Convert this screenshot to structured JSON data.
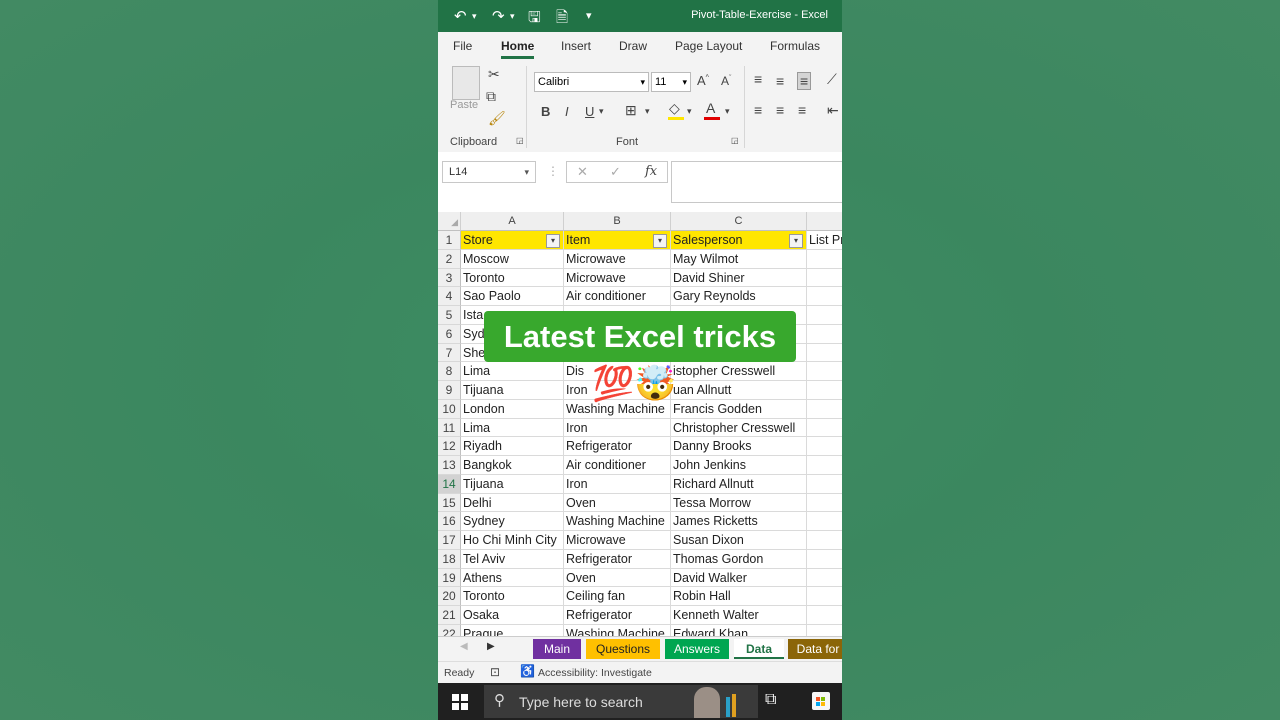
{
  "window": {
    "doc_title": "Pivot-Table-Exercise  -  Excel",
    "quick_access": {
      "undo": "↶",
      "redo": "↷",
      "save": "🖫",
      "touch": "🗎",
      "customize": "▾"
    }
  },
  "ribbon": {
    "tabs": [
      {
        "label": "File",
        "active": false
      },
      {
        "label": "Home",
        "active": true
      },
      {
        "label": "Insert",
        "active": false
      },
      {
        "label": "Draw",
        "active": false
      },
      {
        "label": "Page Layout",
        "active": false
      },
      {
        "label": "Formulas",
        "active": false
      }
    ],
    "clipboard": {
      "paste_label": "Paste",
      "group_label": "Clipboard"
    },
    "font": {
      "family": "Calibri",
      "size": "11",
      "group_label": "Font",
      "bold": "B",
      "italic": "I",
      "underline": "U"
    }
  },
  "formula_bar": {
    "name_box": "L14",
    "fx": "fx",
    "cancel": "✕",
    "enter": "✓",
    "content": ""
  },
  "grid": {
    "columns": [
      {
        "label": "A",
        "header": "Store"
      },
      {
        "label": "B",
        "header": "Item"
      },
      {
        "label": "C",
        "header": "Salesperson"
      },
      {
        "label": "",
        "header": "List Pr"
      }
    ],
    "rows": [
      {
        "num": "2",
        "a": "Moscow",
        "b": "Microwave",
        "c": "May Wilmot"
      },
      {
        "num": "3",
        "a": "Toronto",
        "b": "Microwave",
        "c": "David Shiner"
      },
      {
        "num": "4",
        "a": "Sao Paolo",
        "b": "Air conditioner",
        "c": "Gary Reynolds"
      },
      {
        "num": "5",
        "a": "Ista",
        "b": "",
        "c": ""
      },
      {
        "num": "6",
        "a": "Syd",
        "b": "",
        "c": ""
      },
      {
        "num": "7",
        "a": "She",
        "b": "",
        "c": ""
      },
      {
        "num": "8",
        "a": "Lima",
        "b": "Dis",
        "c": "istopher Cresswell"
      },
      {
        "num": "9",
        "a": "Tijuana",
        "b": "Iron",
        "c": "uan Allnutt"
      },
      {
        "num": "10",
        "a": "London",
        "b": "Washing Machine",
        "c": "Francis Godden"
      },
      {
        "num": "11",
        "a": "Lima",
        "b": "Iron",
        "c": "Christopher Cresswell"
      },
      {
        "num": "12",
        "a": "Riyadh",
        "b": "Refrigerator",
        "c": "Danny Brooks"
      },
      {
        "num": "13",
        "a": "Bangkok",
        "b": "Air conditioner",
        "c": "John Jenkins"
      },
      {
        "num": "14",
        "a": "Tijuana",
        "b": "Iron",
        "c": "Richard Allnutt"
      },
      {
        "num": "15",
        "a": "Delhi",
        "b": "Oven",
        "c": "Tessa Morrow"
      },
      {
        "num": "16",
        "a": "Sydney",
        "b": "Washing Machine",
        "c": "James Ricketts"
      },
      {
        "num": "17",
        "a": "Ho Chi Minh City",
        "b": "Microwave",
        "c": "Susan Dixon"
      },
      {
        "num": "18",
        "a": "Tel Aviv",
        "b": "Refrigerator",
        "c": "Thomas Gordon"
      },
      {
        "num": "19",
        "a": "Athens",
        "b": "Oven",
        "c": "David Walker"
      },
      {
        "num": "20",
        "a": "Toronto",
        "b": "Ceiling fan",
        "c": "Robin Hall"
      },
      {
        "num": "21",
        "a": "Osaka",
        "b": "Refrigerator",
        "c": "Kenneth Walter"
      },
      {
        "num": "22",
        "a": "Prague",
        "b": "Washing Machine",
        "c": "Edward Khan"
      }
    ],
    "selected_row": "14"
  },
  "sheet_tabs": [
    {
      "label": "Main",
      "color": "#7030a0",
      "active": false
    },
    {
      "label": "Questions",
      "color": "#ffc000",
      "active": false
    },
    {
      "label": "Answers",
      "color": "#00a651",
      "active": false
    },
    {
      "label": "Data",
      "color": "#ffffff",
      "active": true
    },
    {
      "label": "Data for",
      "color": "#8b6508",
      "active": false
    }
  ],
  "status": {
    "ready": "Ready",
    "accessibility": "Accessibility: Investigate"
  },
  "taskbar": {
    "search_placeholder": "Type here to search"
  },
  "overlay": {
    "caption": "Latest Excel tricks",
    "emojis": "💯🤯"
  }
}
